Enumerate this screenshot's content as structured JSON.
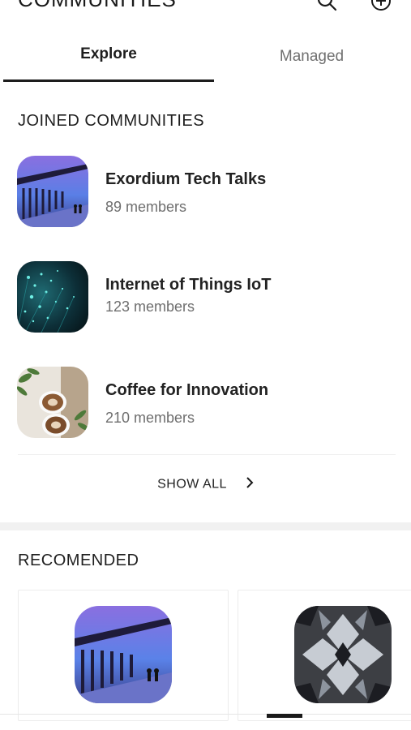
{
  "header": {
    "title": "COMMUNITIES",
    "icons": [
      "search-icon",
      "add-icon"
    ]
  },
  "tabs": [
    {
      "label": "Explore",
      "active": true
    },
    {
      "label": "Managed",
      "active": false
    }
  ],
  "joined": {
    "title": "JOINED COMMUNITIES",
    "items": [
      {
        "name": "Exordium Tech Talks",
        "members": "89 members",
        "image": "tunnel-image"
      },
      {
        "name": "Internet of Things IoT",
        "members": "123 members",
        "image": "fiber-optic-image"
      },
      {
        "name": "Coffee for Innovation",
        "members": "210 members",
        "image": "coffee-image"
      }
    ],
    "show_all": "SHOW ALL"
  },
  "recommended": {
    "title": "RECOMENDED",
    "cards": [
      {
        "image": "tunnel-image"
      },
      {
        "image": "kaleidoscope-image"
      }
    ]
  },
  "colors": {
    "text": "#1c1c1c",
    "muted": "#6e6e6e",
    "accent": "#1d1d1d"
  }
}
